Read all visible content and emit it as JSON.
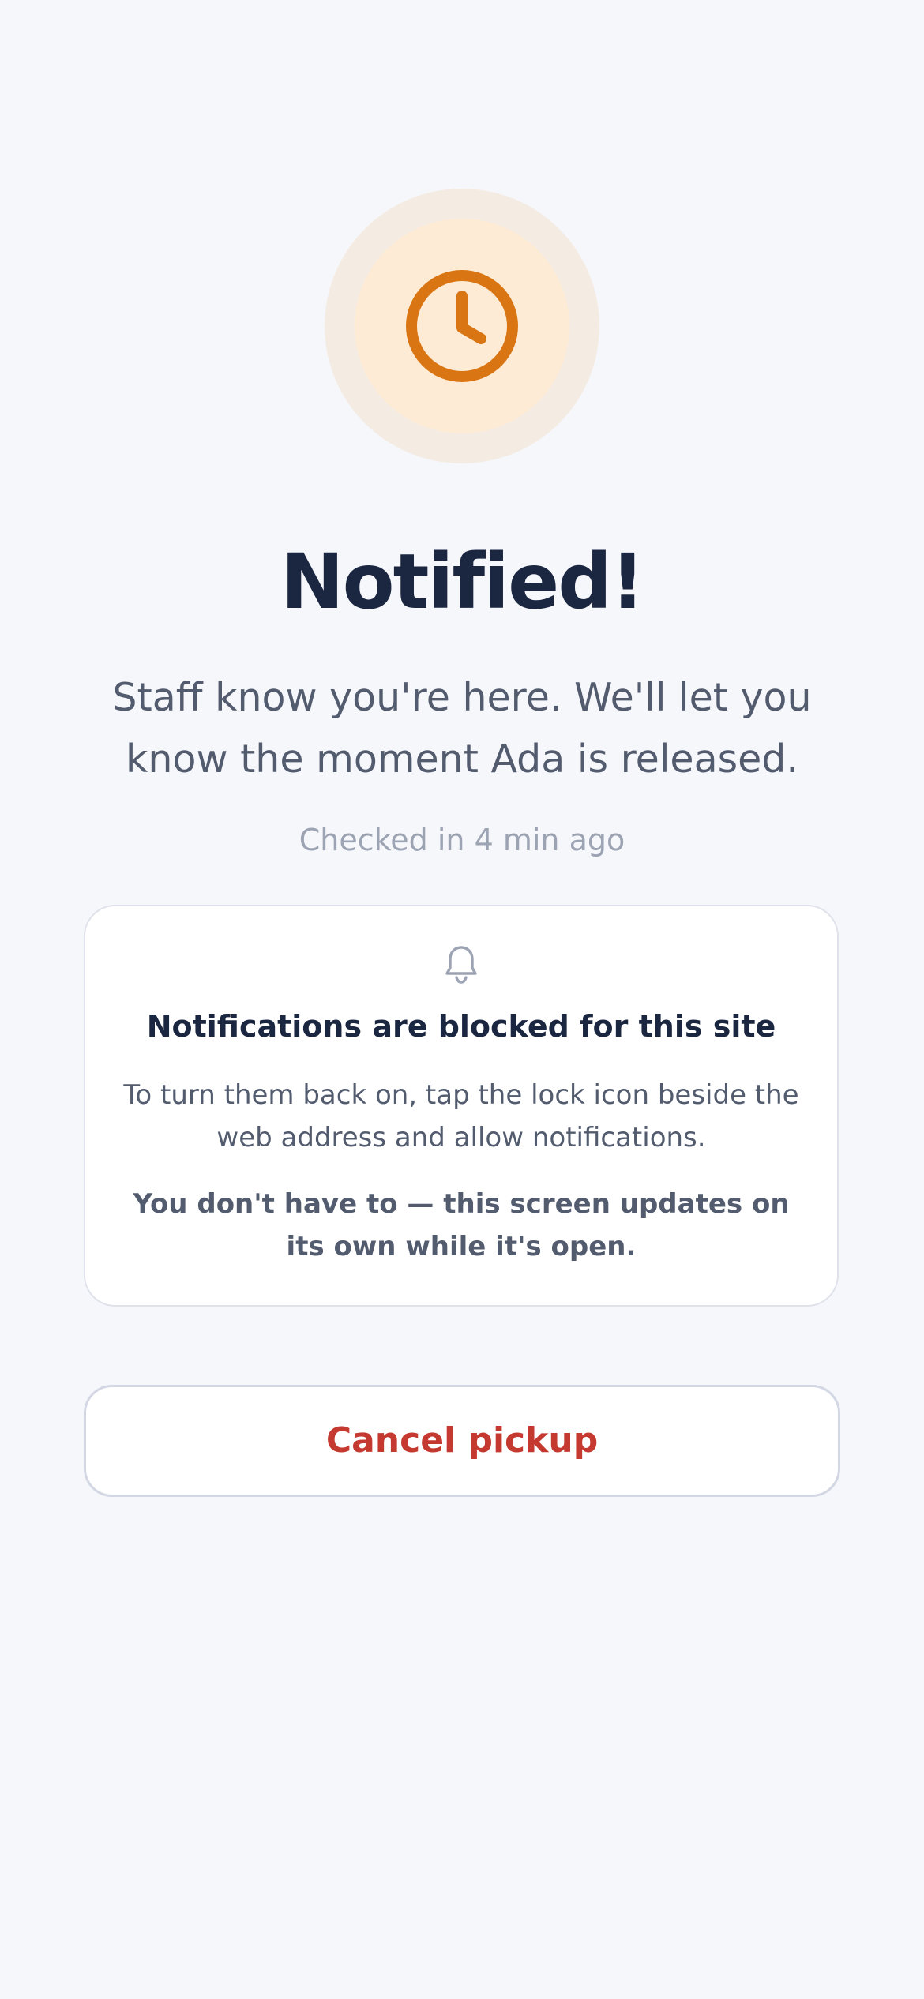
{
  "status": {
    "icon": "clock-icon",
    "title": "Notified!",
    "message": "Staff know you're here. We'll let you know the moment Ada is released.",
    "checked_in": "Checked in 4 min ago"
  },
  "notice": {
    "icon": "bell-icon",
    "heading": "Notifications are blocked for this site",
    "instructions": "To turn them back on, tap the lock icon beside the web address and allow notifications.",
    "reassurance": "You don't have to — this screen updates on its own while it's open."
  },
  "actions": {
    "cancel_label": "Cancel pickup"
  },
  "colors": {
    "accent": "#d97512",
    "accent_soft": "#fdebd6",
    "danger": "#c43a30",
    "text_primary": "#1b2640",
    "text_secondary": "#535c6e",
    "text_muted": "#9ca3b3",
    "background": "#f6f7fb"
  }
}
